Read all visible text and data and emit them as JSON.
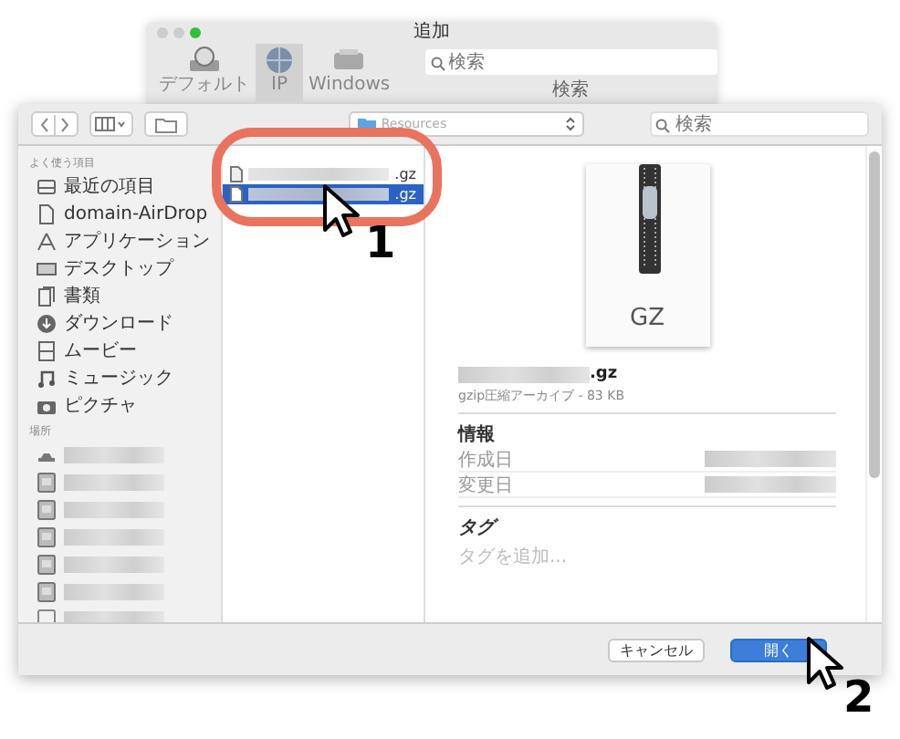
{
  "back_window": {
    "title": "追加",
    "toolbar": [
      {
        "label": "デフォルト",
        "kind": "default",
        "selected": false
      },
      {
        "label": "IP",
        "kind": "ip",
        "selected": true
      },
      {
        "label": "Windows",
        "kind": "windows",
        "selected": false
      }
    ],
    "search": {
      "placeholder": "検索",
      "label": "検索"
    }
  },
  "dialog": {
    "path_popup": "Resources",
    "search": {
      "placeholder": "検索"
    },
    "sidebar": [
      {
        "heading": "よく使う項目",
        "items": [
          {
            "label": "最近の項目",
            "kind": "recents"
          },
          {
            "label": "domain-AirDrop",
            "kind": "document"
          },
          {
            "label": "アプリケーション",
            "kind": "apps"
          },
          {
            "label": "デスクトップ",
            "kind": "desktop"
          },
          {
            "label": "書類",
            "kind": "documents"
          },
          {
            "label": "ダウンロード",
            "kind": "downloads"
          },
          {
            "label": "ムービー",
            "kind": "movies"
          },
          {
            "label": "ミュージック",
            "kind": "music"
          },
          {
            "label": "ピクチャ",
            "kind": "pictures"
          }
        ]
      },
      {
        "heading": "場所",
        "items": [
          {
            "kind": "network"
          },
          {
            "kind": "disk"
          },
          {
            "kind": "disk"
          },
          {
            "kind": "disk"
          },
          {
            "kind": "disk"
          },
          {
            "kind": "disk"
          },
          {
            "kind": "removable"
          }
        ]
      }
    ],
    "files": [
      {
        "name": ".gz",
        "selected": false
      },
      {
        "name": ".gz",
        "selected": true
      }
    ],
    "preview": {
      "icon_label": "GZ",
      "name": ".gz",
      "kind_size": "gzip圧縮アーカイブ - 83 KB",
      "info_heading": "情報",
      "info_rows": [
        {
          "label": "作成日"
        },
        {
          "label": "変更日"
        }
      ],
      "tags_heading": "タグ",
      "tags_placeholder": "タグを追加..."
    },
    "buttons": [
      {
        "label": "キャンセル",
        "kind": "default"
      },
      {
        "label": "開く",
        "kind": "primary"
      }
    ]
  },
  "annotations": [
    {
      "number": "1"
    },
    {
      "number": "2"
    }
  ]
}
